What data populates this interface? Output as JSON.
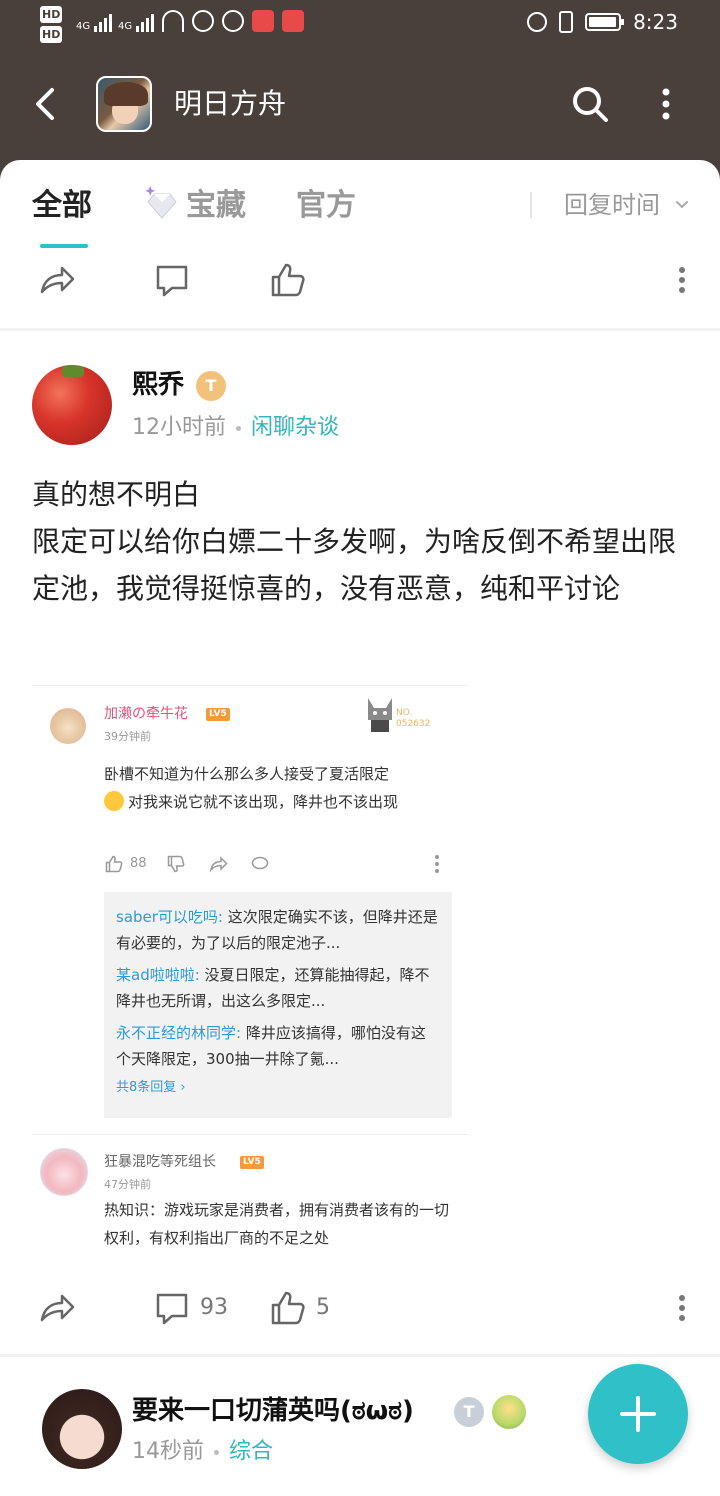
{
  "status_bar": {
    "hd1": "HD",
    "hd2": "HD",
    "signal1": "4G",
    "signal2": "4G",
    "time": "8:23"
  },
  "header": {
    "title": "明日方舟",
    "icons": [
      "back-arrow-icon",
      "search-icon",
      "more-vertical-icon"
    ]
  },
  "tabs": [
    {
      "label": "全部",
      "active": true
    },
    {
      "label": "宝藏",
      "active": false,
      "icon": "diamond-icon"
    },
    {
      "label": "官方",
      "active": false
    }
  ],
  "sort": {
    "label": "回复时间"
  },
  "post_actions_top": {
    "comments": "",
    "likes": ""
  },
  "posts": [
    {
      "username": "熙乔",
      "level": "T",
      "time": "12小时前",
      "category": "闲聊杂谈",
      "lines": [
        "真的想不明白",
        "限定可以给你白嫖二十多发啊，为啥反倒不希望出限定池，我觉得挺惊喜的，没有恶意，纯和平讨论"
      ],
      "embedded": {
        "comment1": {
          "name": "加濑の牵牛花",
          "lv": "LV5",
          "time": "39分钟前",
          "no_label": "NO.",
          "no_value": "052632",
          "text_a": "卧槽不知道为什么那么多人接受了夏活限定",
          "text_b": "对我来说它就不该出现，降井也不该出现",
          "likes": "88"
        },
        "replies": [
          {
            "name": "saber可以吃吗:",
            "text": " 这次限定确实不该，但降井还是有必要的，为了以后的限定池子..."
          },
          {
            "name": "某ad啦啦啦:",
            "text": " 没夏日限定，还算能抽得起，降不降井也无所谓，出这么多限定..."
          },
          {
            "name": "永不正经的林同学:",
            "text": " 降井应该搞得，哪怕没有这个天降限定，300抽一井除了氪..."
          }
        ],
        "total_replies": "共8条回复 ›",
        "comment2": {
          "name": "狂暴混吃等死组长",
          "lv": "LV5",
          "time": "47分钟前",
          "text": "热知识：游戏玩家是消费者，拥有消费者该有的一切权利，有权利指出厂商的不足之处"
        }
      },
      "comments": "93",
      "likes": "5"
    },
    {
      "username": "要来一口切蒲英吗(ಠωಠ)",
      "level": "T",
      "time": "14秒前",
      "category": "综合"
    }
  ],
  "colors": {
    "accent": "#2fc1c7",
    "header_bg": "#4a403b",
    "reply_name": "#2f9bd6",
    "embedded_name": "#e0527a"
  }
}
